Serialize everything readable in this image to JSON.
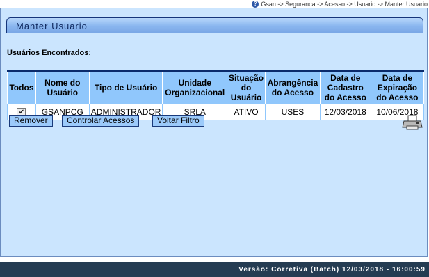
{
  "breadcrumb": {
    "text": "Gsan -> Seguranca -> Acesso -> Usuario -> Manter Usuario"
  },
  "page": {
    "title": "Manter Usuario",
    "section_label": "Usuários Encontrados:"
  },
  "table": {
    "headers": {
      "todos": "Todos",
      "nome1": "Nome do",
      "nome2": "Usuário",
      "tipo": "Tipo de Usuário",
      "unidade1": "Unidade",
      "unidade2": "Organizacional",
      "situacao1": "Situação",
      "situacao2": "do",
      "situacao3": "Usuário",
      "abrangencia1": "Abrangência",
      "abrangencia2": "do Acesso",
      "cadastro1": "Data de",
      "cadastro2": "Cadastro",
      "cadastro3": "do Acesso",
      "expiracao1": "Data de",
      "expiracao2": "Expiração",
      "expiracao3": "do Acesso"
    },
    "rows": [
      {
        "checked": "✔",
        "login": "GSANPCG",
        "tipo": "ADMINISTRADOR",
        "unidade": "SRLA",
        "situacao": "ATIVO",
        "abrangencia": "USES",
        "cadastro": "12/03/2018",
        "expiracao": "10/06/2018"
      }
    ]
  },
  "buttons": {
    "remover": "Remover",
    "controlar": "Controlar Acessos",
    "voltar": "Voltar Filtro"
  },
  "footer": {
    "text": "Versão: Corretiva (Batch) 12/03/2018 - 16:00:59"
  },
  "colors": {
    "panel_bg": "#cbe5fe",
    "header_bg": "#90c7fc",
    "footer_bg": "#253c52"
  },
  "icons": {
    "help": "help-icon",
    "print": "printer-icon"
  }
}
